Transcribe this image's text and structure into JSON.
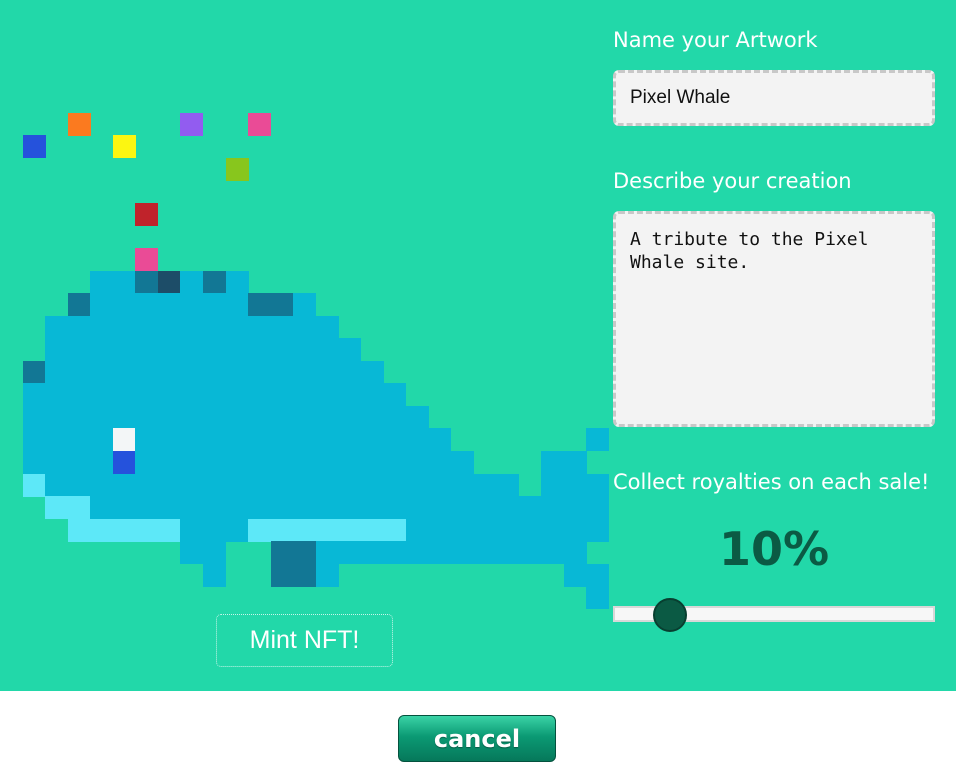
{
  "theme": {
    "background": "#22d8a9",
    "whale_body": "#08b8d6",
    "whale_dark": "#127795",
    "whale_light": "#5de8f8",
    "accent_dark": "#0b5a44"
  },
  "artwork": {
    "grid_columns": 26,
    "palette": {
      "b": "#08b8d6",
      "d": "#127795",
      "l": "#5de8f8",
      "n": "#1d4d68",
      "w": "#f3f6f7",
      "u": "#2552dc",
      "r": "#c0232b",
      "p": "#ea4b96",
      "o": "#fb7a1f",
      "y": "#fcf611",
      "v": "#925cf0",
      "g": "#88c61d"
    },
    "rows": [
      "",
      "",
      "",
      "",
      "",
      "   o    v  p",
      " u   y",
      "          g",
      "",
      "      r",
      "",
      "      p",
      "    bbdnbdb",
      "   dbbbbbbbddb",
      "  bbbbbbbbbbbbb",
      "  bbbbbbbbbbbbbb",
      " dbbbbbbbbbbbbbbb",
      " bbbbbbbbbbbbbbbbb",
      " bbbbbbbbbbbbbbbbbb",
      " bbbbwbbbbbbbbbbbbbb      b",
      " bbbbubbbbbbbbbbbbbbb   bb",
      " lbbbbbbbbbbbbbbbbbbbbb bbb",
      "  llbbbbbbbbbbbbbbbbbbbbbbb",
      "   lllllbbblllllllbbbbbbbbb",
      "        bb  ddbbbbbbbbbbbb",
      "         b  ddb          bb",
      "                          b"
    ]
  },
  "mint_button": {
    "label": "Mint NFT!"
  },
  "name_section": {
    "label": "Name your Artwork",
    "value": "Pixel Whale"
  },
  "description_section": {
    "label": "Describe your creation",
    "value": "A tribute to the Pixel Whale site."
  },
  "royalty_section": {
    "label": "Collect royalties on each sale!",
    "display": "10%",
    "value_percent": 10,
    "slider_fraction": 0.14
  },
  "cancel_button": {
    "label": "cancel"
  }
}
